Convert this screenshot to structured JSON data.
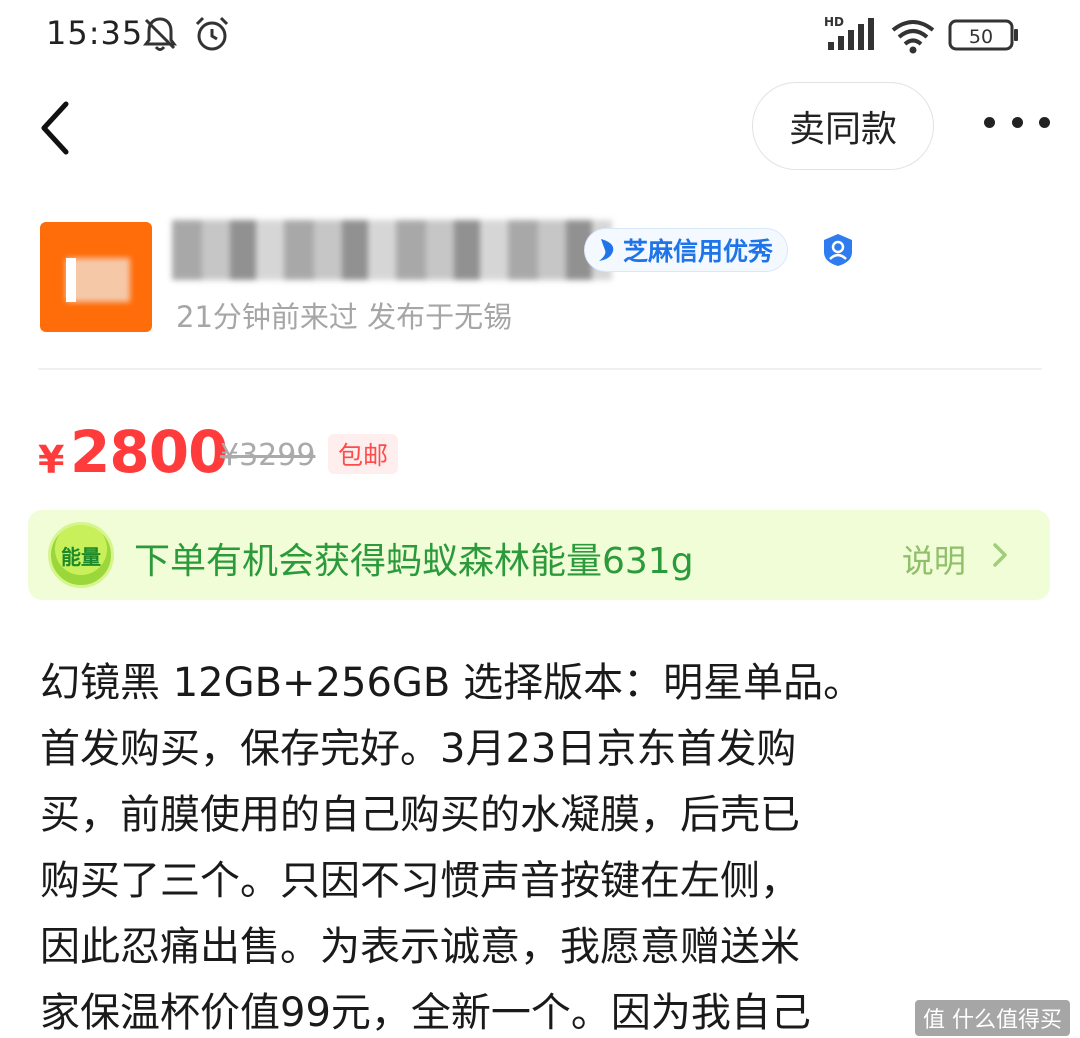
{
  "status": {
    "time": "15:35",
    "network": "HD",
    "battery": "50"
  },
  "nav": {
    "sell_same_label": "卖同款"
  },
  "seller": {
    "sesame_label": "芝麻信用优秀",
    "meta": "21分钟前来过 发布于无锡"
  },
  "price": {
    "currency": "¥",
    "value": "2800",
    "original": "¥3299",
    "shipping_tag": "包邮"
  },
  "energy": {
    "badge": "能量",
    "text": "下单有机会获得蚂蚁森林能量631g",
    "help": "说明"
  },
  "description": {
    "lines": [
      "幻镜黑 12GB+256GB 选择版本：明星单品。",
      "首发购买，保存完好。3月23日京东首发购",
      "买，前膜使用的自己购买的水凝膜，后壳已",
      "购买了三个。只因不习惯声音按键在左侧，",
      "因此忍痛出售。为表示诚意，我愿意赠送米",
      "家保温杯价值99元，全新一个。因为我自己"
    ]
  },
  "watermark": "值 什么值得买"
}
